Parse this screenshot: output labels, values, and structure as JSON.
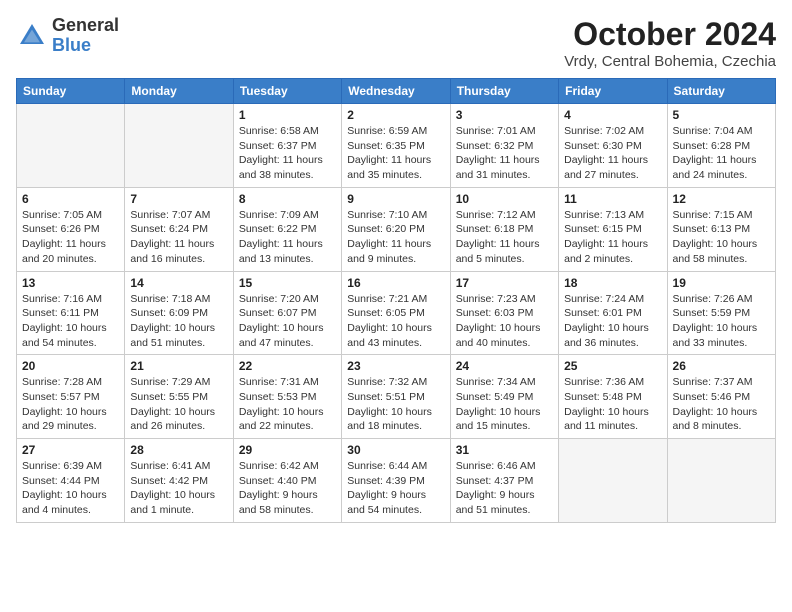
{
  "logo": {
    "general": "General",
    "blue": "Blue"
  },
  "title": {
    "month": "October 2024",
    "location": "Vrdy, Central Bohemia, Czechia"
  },
  "headers": [
    "Sunday",
    "Monday",
    "Tuesday",
    "Wednesday",
    "Thursday",
    "Friday",
    "Saturday"
  ],
  "weeks": [
    [
      {
        "day": "",
        "info": ""
      },
      {
        "day": "",
        "info": ""
      },
      {
        "day": "1",
        "info": "Sunrise: 6:58 AM\nSunset: 6:37 PM\nDaylight: 11 hours and 38 minutes."
      },
      {
        "day": "2",
        "info": "Sunrise: 6:59 AM\nSunset: 6:35 PM\nDaylight: 11 hours and 35 minutes."
      },
      {
        "day": "3",
        "info": "Sunrise: 7:01 AM\nSunset: 6:32 PM\nDaylight: 11 hours and 31 minutes."
      },
      {
        "day": "4",
        "info": "Sunrise: 7:02 AM\nSunset: 6:30 PM\nDaylight: 11 hours and 27 minutes."
      },
      {
        "day": "5",
        "info": "Sunrise: 7:04 AM\nSunset: 6:28 PM\nDaylight: 11 hours and 24 minutes."
      }
    ],
    [
      {
        "day": "6",
        "info": "Sunrise: 7:05 AM\nSunset: 6:26 PM\nDaylight: 11 hours and 20 minutes."
      },
      {
        "day": "7",
        "info": "Sunrise: 7:07 AM\nSunset: 6:24 PM\nDaylight: 11 hours and 16 minutes."
      },
      {
        "day": "8",
        "info": "Sunrise: 7:09 AM\nSunset: 6:22 PM\nDaylight: 11 hours and 13 minutes."
      },
      {
        "day": "9",
        "info": "Sunrise: 7:10 AM\nSunset: 6:20 PM\nDaylight: 11 hours and 9 minutes."
      },
      {
        "day": "10",
        "info": "Sunrise: 7:12 AM\nSunset: 6:18 PM\nDaylight: 11 hours and 5 minutes."
      },
      {
        "day": "11",
        "info": "Sunrise: 7:13 AM\nSunset: 6:15 PM\nDaylight: 11 hours and 2 minutes."
      },
      {
        "day": "12",
        "info": "Sunrise: 7:15 AM\nSunset: 6:13 PM\nDaylight: 10 hours and 58 minutes."
      }
    ],
    [
      {
        "day": "13",
        "info": "Sunrise: 7:16 AM\nSunset: 6:11 PM\nDaylight: 10 hours and 54 minutes."
      },
      {
        "day": "14",
        "info": "Sunrise: 7:18 AM\nSunset: 6:09 PM\nDaylight: 10 hours and 51 minutes."
      },
      {
        "day": "15",
        "info": "Sunrise: 7:20 AM\nSunset: 6:07 PM\nDaylight: 10 hours and 47 minutes."
      },
      {
        "day": "16",
        "info": "Sunrise: 7:21 AM\nSunset: 6:05 PM\nDaylight: 10 hours and 43 minutes."
      },
      {
        "day": "17",
        "info": "Sunrise: 7:23 AM\nSunset: 6:03 PM\nDaylight: 10 hours and 40 minutes."
      },
      {
        "day": "18",
        "info": "Sunrise: 7:24 AM\nSunset: 6:01 PM\nDaylight: 10 hours and 36 minutes."
      },
      {
        "day": "19",
        "info": "Sunrise: 7:26 AM\nSunset: 5:59 PM\nDaylight: 10 hours and 33 minutes."
      }
    ],
    [
      {
        "day": "20",
        "info": "Sunrise: 7:28 AM\nSunset: 5:57 PM\nDaylight: 10 hours and 29 minutes."
      },
      {
        "day": "21",
        "info": "Sunrise: 7:29 AM\nSunset: 5:55 PM\nDaylight: 10 hours and 26 minutes."
      },
      {
        "day": "22",
        "info": "Sunrise: 7:31 AM\nSunset: 5:53 PM\nDaylight: 10 hours and 22 minutes."
      },
      {
        "day": "23",
        "info": "Sunrise: 7:32 AM\nSunset: 5:51 PM\nDaylight: 10 hours and 18 minutes."
      },
      {
        "day": "24",
        "info": "Sunrise: 7:34 AM\nSunset: 5:49 PM\nDaylight: 10 hours and 15 minutes."
      },
      {
        "day": "25",
        "info": "Sunrise: 7:36 AM\nSunset: 5:48 PM\nDaylight: 10 hours and 11 minutes."
      },
      {
        "day": "26",
        "info": "Sunrise: 7:37 AM\nSunset: 5:46 PM\nDaylight: 10 hours and 8 minutes."
      }
    ],
    [
      {
        "day": "27",
        "info": "Sunrise: 6:39 AM\nSunset: 4:44 PM\nDaylight: 10 hours and 4 minutes."
      },
      {
        "day": "28",
        "info": "Sunrise: 6:41 AM\nSunset: 4:42 PM\nDaylight: 10 hours and 1 minute."
      },
      {
        "day": "29",
        "info": "Sunrise: 6:42 AM\nSunset: 4:40 PM\nDaylight: 9 hours and 58 minutes."
      },
      {
        "day": "30",
        "info": "Sunrise: 6:44 AM\nSunset: 4:39 PM\nDaylight: 9 hours and 54 minutes."
      },
      {
        "day": "31",
        "info": "Sunrise: 6:46 AM\nSunset: 4:37 PM\nDaylight: 9 hours and 51 minutes."
      },
      {
        "day": "",
        "info": ""
      },
      {
        "day": "",
        "info": ""
      }
    ]
  ]
}
